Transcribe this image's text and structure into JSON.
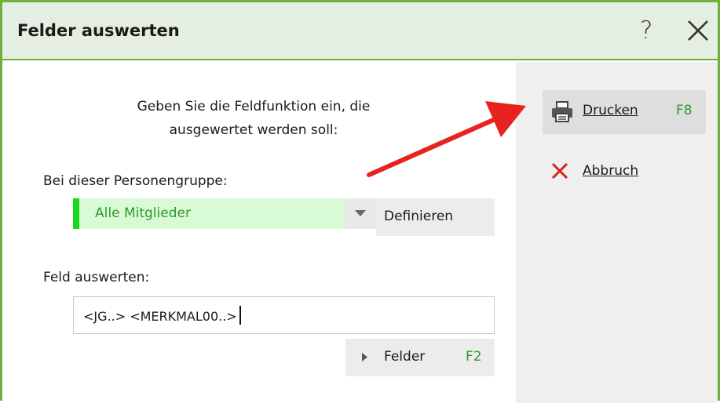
{
  "window": {
    "title": "Felder auswerten",
    "help_symbol": "?",
    "accent_color": "#6fae3f"
  },
  "form": {
    "instruction": "Geben Sie die Feldfunktion ein, die ausgewertet werden soll:",
    "group_label": "Bei dieser Personengruppe:",
    "group_value": "Alle Mitglieder",
    "define_label": "Definieren",
    "field_label": "Feld auswerten:",
    "field_value": "<JG..> <MERKMAL00..>",
    "fields_button_label": "Felder",
    "fields_button_key": "F2"
  },
  "side": {
    "print_label": "Drucken",
    "print_key": "F8",
    "abort_label": "Abbruch",
    "icons": [
      "printer-icon",
      "cancel-x-icon"
    ]
  },
  "annotation": {
    "arrow_color": "#e8231f"
  }
}
